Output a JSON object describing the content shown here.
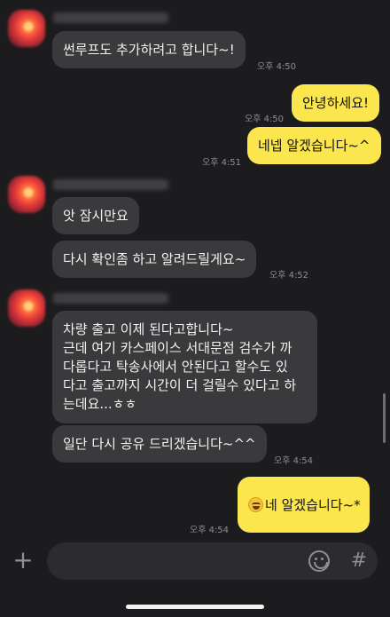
{
  "messages": [
    {
      "text": "썬루프도 추가하려고 합니다~!",
      "time": "오후 4:50"
    },
    {
      "text": "안녕하세요!",
      "time": "오후 4:50"
    },
    {
      "text": "네넵 알겠습니다~^",
      "time": "오후 4:51"
    },
    {
      "text": "앗 잠시만요"
    },
    {
      "text": "다시 확인좀 하고 알려드릴게요~",
      "time": "오후 4:52"
    },
    {
      "lines": [
        "차량 출고 이제 된다고합니다~",
        "근데 여기 카스페이스 서대문점 검수가 까",
        "다롭다고 탁송사에서 안된다고 할수도 있",
        "다고 출고까지 시간이 더 걸릴수 있다고 하",
        "는데요...ㅎㅎ"
      ]
    },
    {
      "text": "일단 다시 공유 드리겠습니다~^^",
      "time": "오후 4:54"
    },
    {
      "text": "네 알겠습니다~*",
      "time": "오후 4:54",
      "emoji": "grin-sweat-emoji"
    }
  ],
  "input": {
    "plus_icon": "+",
    "hash_icon": "#"
  },
  "colors": {
    "background": "#1c1c1e",
    "incoming": "#3a3a3c",
    "outgoing": "#fbe64d",
    "time": "#8e8e93"
  }
}
